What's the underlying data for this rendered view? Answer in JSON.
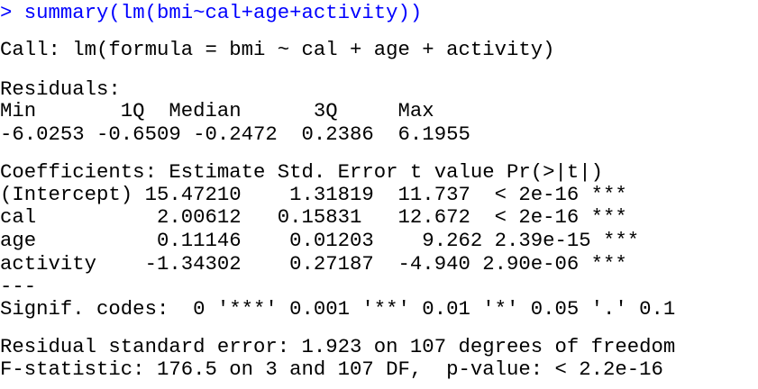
{
  "console": {
    "prompt": "> ",
    "command": "summary(lm(bmi~cal+age+activity))",
    "call_line": "Call: lm(formula = bmi ~ cal + age + activity)",
    "residuals_header": "Residuals:",
    "residuals_columns": "Min       1Q  Median      3Q     Max",
    "residuals_values": "-6.0253 -0.6509 -0.2472  0.2386  6.1955",
    "coefficients_header": "Coefficients: Estimate Std. Error t value Pr(>|t|)",
    "coef_rows": [
      "(Intercept) 15.47210    1.31819  11.737  < 2e-16 ***",
      "cal          2.00612   0.15831   12.672  < 2e-16 ***",
      "age          0.11146    0.01203    9.262 2.39e-15 ***",
      "activity    -1.34302    0.27187  -4.940 2.90e-06 ***"
    ],
    "separator": "---",
    "signif_codes": "Signif. codes:  0 '***' 0.001 '**' 0.01 '*' 0.05 '.' 0.1",
    "residual_se": "Residual standard error: 1.923 on 107 degrees of freedom",
    "f_statistic": "F-statistic: 176.5 on 3 and 107 DF,  p-value: < 2.2e-16"
  },
  "colors": {
    "command": "#0000ff",
    "output": "#000000",
    "background": "#ffffff"
  }
}
